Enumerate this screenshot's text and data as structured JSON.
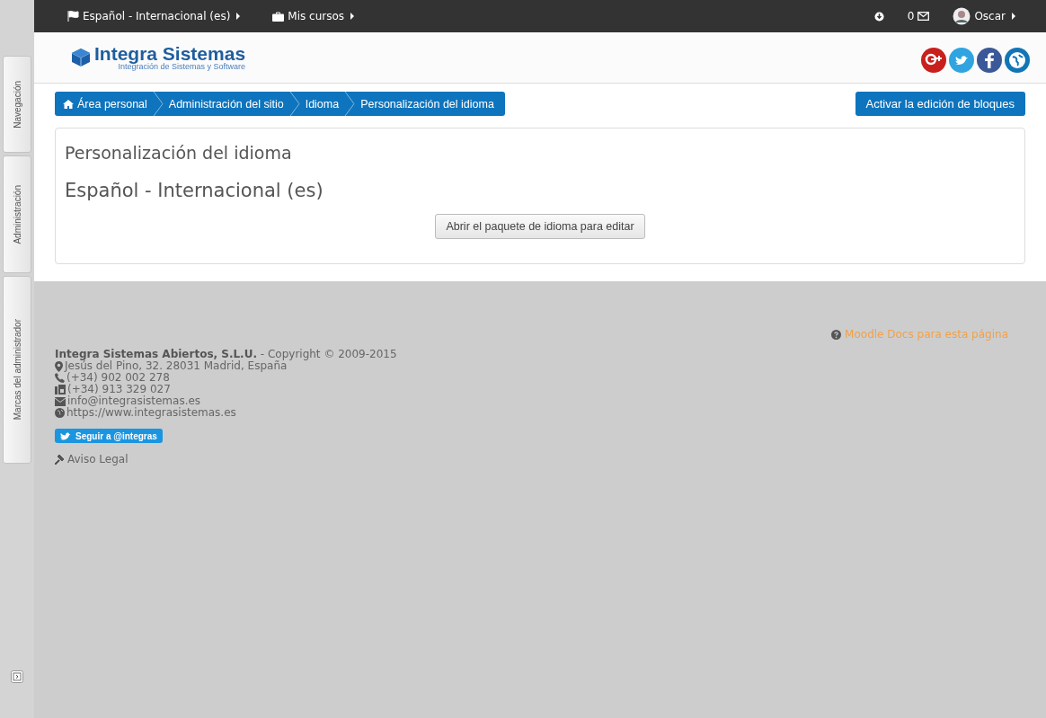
{
  "top_bar": {
    "language_menu": "Español - Internacional (es)",
    "courses_menu": "Mis cursos",
    "message_count": "0",
    "user_name": "Oscar"
  },
  "logo": {
    "name": "Integra Sistemas",
    "tagline": "Integración de Sistemas y Software"
  },
  "dock_tabs": [
    "Navegación",
    "Administración",
    "Marcas del administrador"
  ],
  "breadcrumb": [
    "Área personal",
    "Administración del sitio",
    "Idioma",
    "Personalización del idioma"
  ],
  "edit_button": "Activar la edición de bloques",
  "page": {
    "heading": "Personalización del idioma",
    "subheading": "Español - Internacional (es)",
    "button": "Abrir el paquete de idioma para editar"
  },
  "footer": {
    "docs_link": "Moodle Docs para esta página",
    "company_line": "**Integra Sistemas Abiertos, S.L.U.** - Copyright © 2009-2015",
    "contacts": [
      {
        "kind": "address",
        "text": "Jesús del Pino, 32. 28031 Madrid, España"
      },
      {
        "kind": "phone",
        "text": "(+34) 902 002 278"
      },
      {
        "kind": "fax",
        "text": "(+34) 913 329 027"
      },
      {
        "kind": "email",
        "text": "info@integrasistemas.es"
      },
      {
        "kind": "web",
        "text": "https://www.integrasistemas.es"
      }
    ],
    "follow_button": "Seguir a @integras",
    "legal_link": "Aviso Legal"
  }
}
